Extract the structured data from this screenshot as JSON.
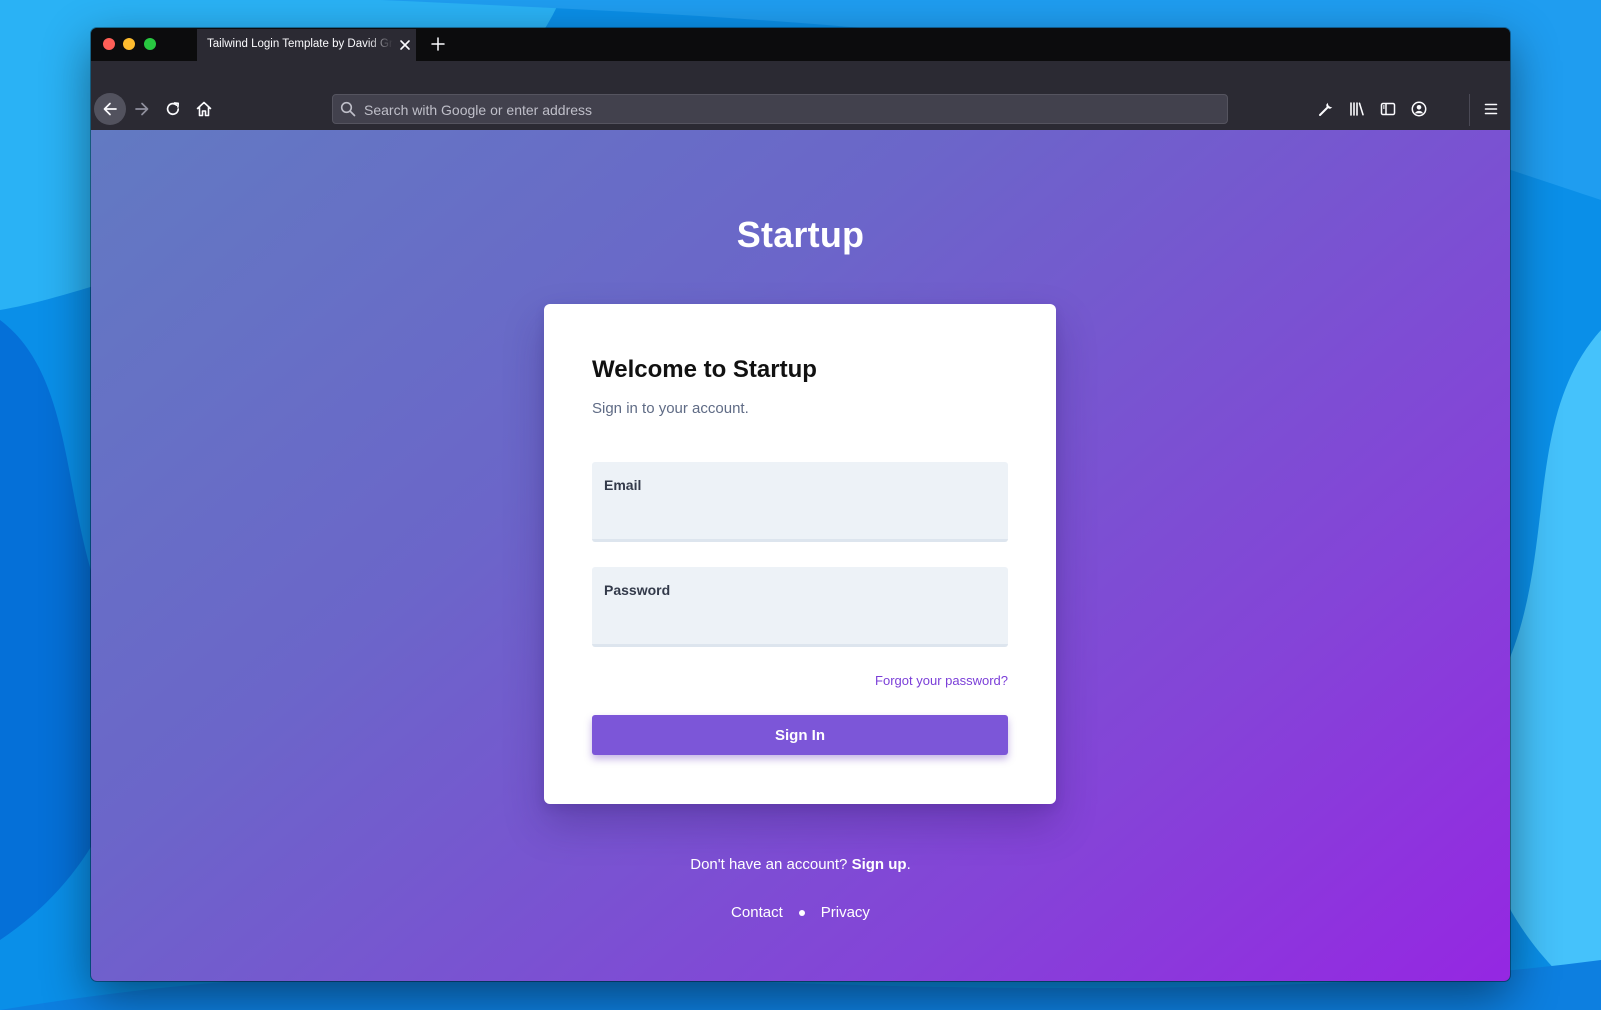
{
  "browser": {
    "tab_title": "Tailwind Login Template by David Grzyb",
    "url_placeholder": "Search with Google or enter address",
    "icons": {
      "back": "back-arrow-icon",
      "forward": "forward-arrow-icon",
      "reload": "reload-icon",
      "home": "home-icon",
      "search": "search-icon",
      "tools": "wrench-icon",
      "library": "library-icon",
      "sidebar": "sidebar-icon",
      "account": "account-icon",
      "menu": "hamburger-menu-icon"
    }
  },
  "page": {
    "brand": "Startup",
    "card": {
      "title": "Welcome to Startup",
      "subtitle": "Sign in to your account.",
      "email_label": "Email",
      "email_value": "",
      "password_label": "Password",
      "password_value": "",
      "forgot_link": "Forgot your password?",
      "signin_button": "Sign In"
    },
    "signup_prompt": "Don't have an account?",
    "signup_link": "Sign up",
    "signup_period": ".",
    "footer": {
      "contact": "Contact",
      "privacy": "Privacy"
    }
  },
  "colors": {
    "accent": "#7c56d8",
    "link": "#7b3fd8",
    "gradient_start": "#627ac2",
    "gradient_end": "#9527e2"
  }
}
